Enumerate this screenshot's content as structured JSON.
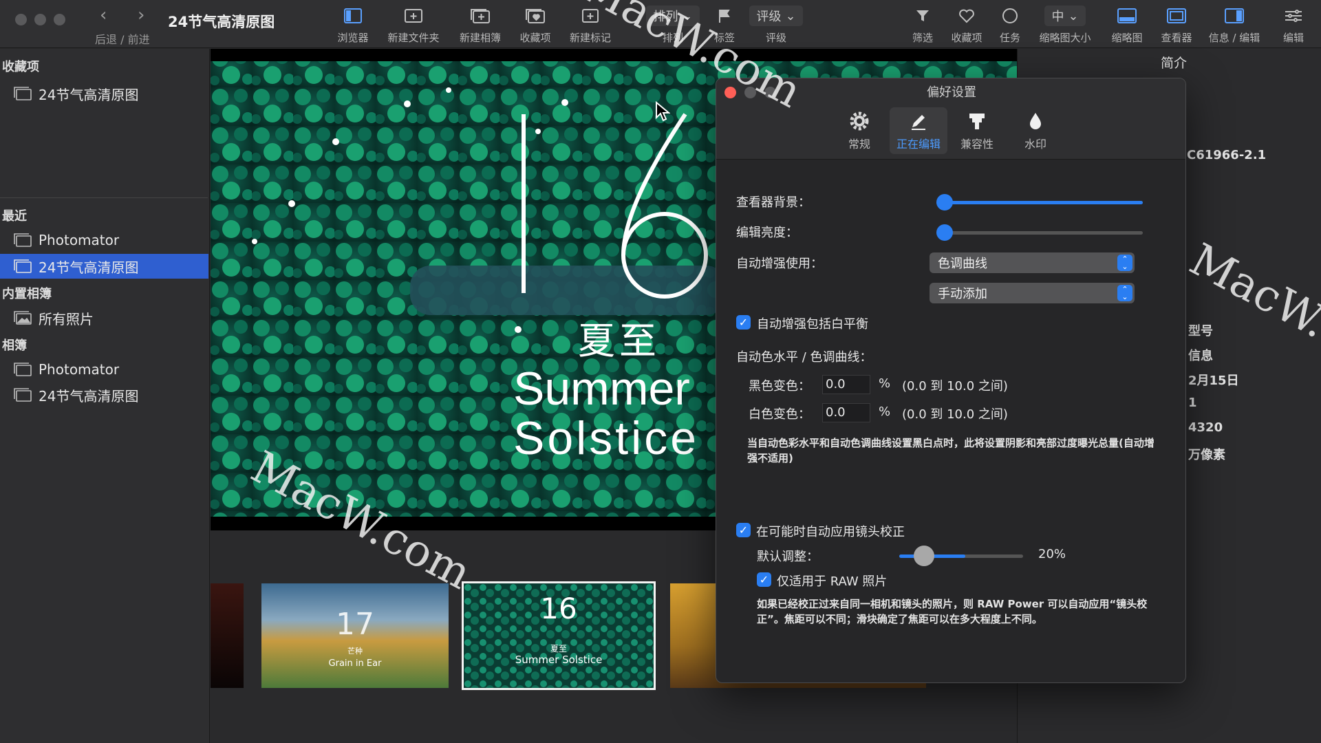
{
  "window": {
    "title": "24节气高清原图",
    "nav_label": "后退 / 前进"
  },
  "toolbar": {
    "items": [
      {
        "label": "浏览器",
        "icon": "browser-icon"
      },
      {
        "label": "新建文件夹",
        "icon": "new-folder-icon"
      },
      {
        "label": "新建相簿",
        "icon": "new-album-icon"
      },
      {
        "label": "收藏项",
        "icon": "favorites-icon"
      },
      {
        "label": "新建标记",
        "icon": "new-tag-icon"
      },
      {
        "label": "排列",
        "icon": "sort-icon"
      },
      {
        "label": "标签",
        "icon": "flag-icon"
      },
      {
        "label": "评级",
        "icon": "rating-icon"
      },
      {
        "label": "筛选",
        "icon": "filter-icon"
      },
      {
        "label": "收藏项",
        "icon": "heart-icon"
      },
      {
        "label": "任务",
        "icon": "tasks-icon"
      },
      {
        "label": "缩略图大小",
        "icon": "thumb-size-icon"
      },
      {
        "label": "缩略图",
        "icon": "thumbnails-icon"
      },
      {
        "label": "查看器",
        "icon": "viewer-icon"
      },
      {
        "label": "信息 / 编辑",
        "icon": "info-edit-icon"
      },
      {
        "label": "编辑",
        "icon": "adjust-icon"
      }
    ],
    "sort_popup": "排列",
    "rating_popup": "评级",
    "thumb_size_popup": "中"
  },
  "sidebar": {
    "favorites_header": "收藏项",
    "favorites": [
      "24节气高清原图"
    ],
    "recent_header": "最近",
    "recent": [
      "Photomator",
      "24节气高清原图"
    ],
    "builtin_header": "内置相簿",
    "builtin": [
      "所有照片"
    ],
    "albums_header": "相簿",
    "albums": [
      "Photomator",
      "24节气高清原图"
    ]
  },
  "viewer": {
    "photo_number": "16",
    "photo_cn": "夏至",
    "photo_en_1": "Summer",
    "photo_en_2": "Solstice",
    "thumbs": [
      {
        "cn": "",
        "en": ""
      },
      {
        "cn": "芒种",
        "en": "Grain in Ear",
        "num": "17"
      },
      {
        "cn": "夏至",
        "en": "Summer Solstice",
        "num": "16"
      },
      {
        "cn": "",
        "en": ""
      }
    ]
  },
  "info_panel": {
    "title": "简介",
    "values": [
      "C61966-2.1",
      "型号",
      "信息",
      "2月15日",
      "1",
      "4320",
      "万像素"
    ]
  },
  "prefs": {
    "title": "偏好设置",
    "tabs": [
      {
        "label": "常规",
        "icon": "gear-icon"
      },
      {
        "label": "正在编辑",
        "icon": "pencil-icon"
      },
      {
        "label": "兼容性",
        "icon": "plug-icon"
      },
      {
        "label": "水印",
        "icon": "drop-icon"
      }
    ],
    "active_tab": "正在编辑",
    "viewer_bg_label": "查看器背景：",
    "viewer_bg_value": 0.0,
    "edit_brightness_label": "编辑亮度：",
    "edit_brightness_value": 0.0,
    "auto_enhance_label": "自动增强使用：",
    "auto_enhance_option": "色调曲线",
    "auto_enhance_add": "手动添加",
    "include_wb_label": "自动增强包括白平衡",
    "include_wb_checked": true,
    "levels_curve_label": "自动色水平 / 色调曲线：",
    "black_clip_label": "黑色变色：",
    "black_clip_value": "0.0",
    "white_clip_label": "白色变色：",
    "white_clip_value": "0.0",
    "percent": "%",
    "range_hint": "(0.0 到 10.0 之间)",
    "clip_note": "当自动色彩水平和自动色调曲线设置黑白点时，此将设置阴影和亮部过度曝光总量(自动增强不适用)",
    "lens_correction_label": "在可能时自动应用镜头校正",
    "lens_correction_checked": true,
    "default_adjust_label": "默认调整：",
    "default_adjust_value": "20%",
    "default_adjust_level": 0.2,
    "raw_only_label": "仅适用于 RAW 照片",
    "raw_only_checked": true,
    "lens_note": "如果已经校正过来自同一相机和镜头的照片，则 RAW Power 可以自动应用“镜头校正”。焦距可以不同；滑块确定了焦距可以在多大程度上不同。"
  },
  "watermark": "MacW.com",
  "colors": {
    "accent": "#2a7ef2",
    "selection": "#2f5fd0",
    "close": "#ff5f57"
  }
}
